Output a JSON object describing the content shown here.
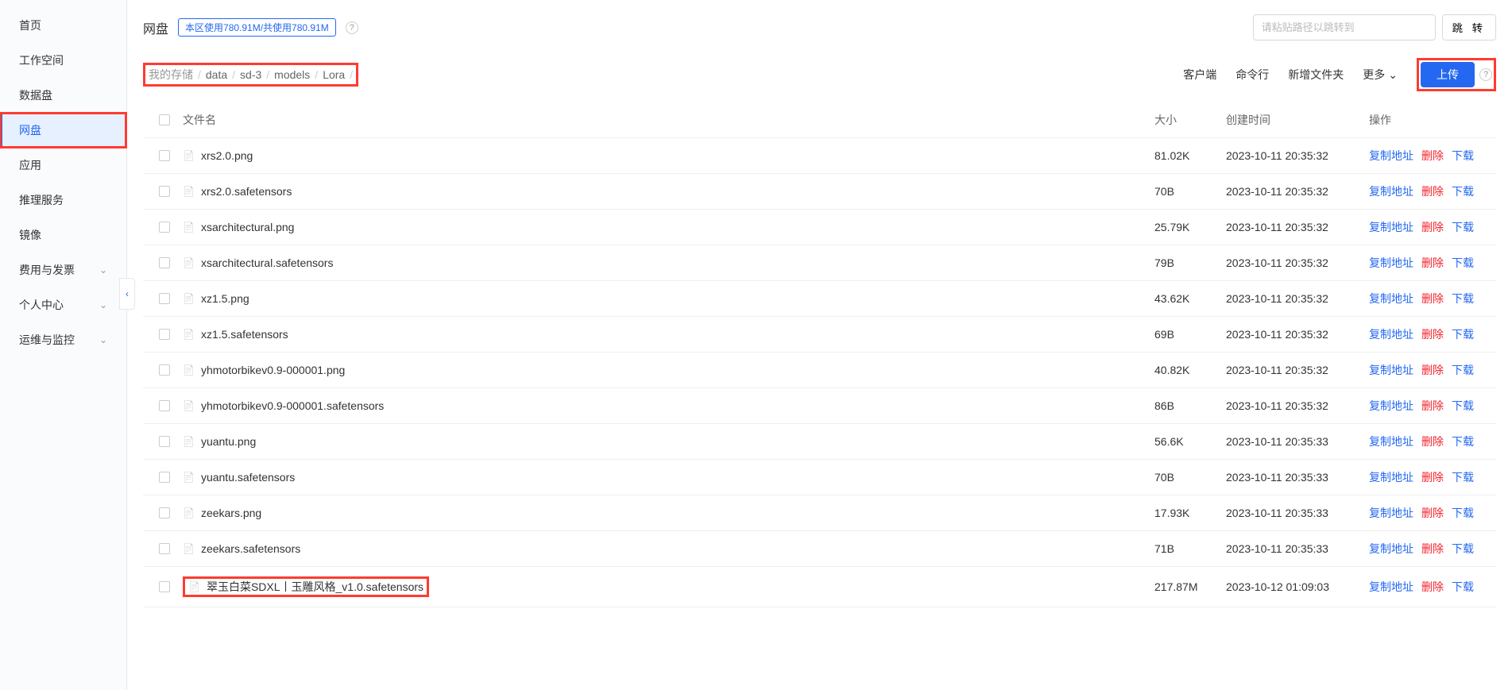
{
  "sidebar": {
    "items": [
      {
        "label": "首页",
        "active": false,
        "expandable": false
      },
      {
        "label": "工作空间",
        "active": false,
        "expandable": false
      },
      {
        "label": "数据盘",
        "active": false,
        "expandable": false
      },
      {
        "label": "网盘",
        "active": true,
        "expandable": false
      },
      {
        "label": "应用",
        "active": false,
        "expandable": false
      },
      {
        "label": "推理服务",
        "active": false,
        "expandable": false
      },
      {
        "label": "镜像",
        "active": false,
        "expandable": false
      },
      {
        "label": "费用与发票",
        "active": false,
        "expandable": true
      },
      {
        "label": "个人中心",
        "active": false,
        "expandable": true
      },
      {
        "label": "运维与监控",
        "active": false,
        "expandable": true
      }
    ]
  },
  "header": {
    "title": "网盘",
    "usage": "本区使用780.91M/共使用780.91M",
    "path_placeholder": "请粘贴路径以跳转到",
    "jump_label": "跳 转"
  },
  "breadcrumb": {
    "items": [
      "我的存储",
      "data",
      "sd-3",
      "models",
      "Lora"
    ]
  },
  "toolbar": {
    "client": "客户端",
    "cli": "命令行",
    "new_folder": "新增文件夹",
    "more": "更多",
    "upload": "上传"
  },
  "table": {
    "headers": {
      "name": "文件名",
      "size": "大小",
      "time": "创建时间",
      "ops": "操作"
    },
    "ops": {
      "copy": "复制地址",
      "delete": "删除",
      "download": "下载"
    },
    "rows": [
      {
        "name": "xrs2.0.png",
        "size": "81.02K",
        "time": "2023-10-11 20:35:32",
        "highlight": false
      },
      {
        "name": "xrs2.0.safetensors",
        "size": "70B",
        "time": "2023-10-11 20:35:32",
        "highlight": false
      },
      {
        "name": "xsarchitectural.png",
        "size": "25.79K",
        "time": "2023-10-11 20:35:32",
        "highlight": false
      },
      {
        "name": "xsarchitectural.safetensors",
        "size": "79B",
        "time": "2023-10-11 20:35:32",
        "highlight": false
      },
      {
        "name": "xz1.5.png",
        "size": "43.62K",
        "time": "2023-10-11 20:35:32",
        "highlight": false
      },
      {
        "name": "xz1.5.safetensors",
        "size": "69B",
        "time": "2023-10-11 20:35:32",
        "highlight": false
      },
      {
        "name": "yhmotorbikev0.9-000001.png",
        "size": "40.82K",
        "time": "2023-10-11 20:35:32",
        "highlight": false
      },
      {
        "name": "yhmotorbikev0.9-000001.safetensors",
        "size": "86B",
        "time": "2023-10-11 20:35:32",
        "highlight": false
      },
      {
        "name": "yuantu.png",
        "size": "56.6K",
        "time": "2023-10-11 20:35:33",
        "highlight": false
      },
      {
        "name": "yuantu.safetensors",
        "size": "70B",
        "time": "2023-10-11 20:35:33",
        "highlight": false
      },
      {
        "name": "zeekars.png",
        "size": "17.93K",
        "time": "2023-10-11 20:35:33",
        "highlight": false
      },
      {
        "name": "zeekars.safetensors",
        "size": "71B",
        "time": "2023-10-11 20:35:33",
        "highlight": false
      },
      {
        "name": "翠玉白菜SDXL丨玉雕风格_v1.0.safetensors",
        "size": "217.87M",
        "time": "2023-10-12 01:09:03",
        "highlight": true
      }
    ]
  }
}
